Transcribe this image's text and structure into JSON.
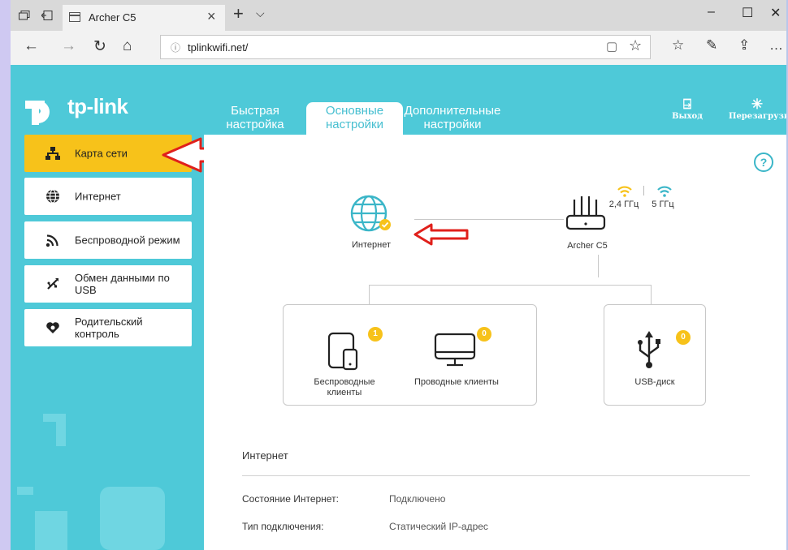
{
  "browser": {
    "tab_title": "Archer C5",
    "url": "tplinkwifi.net/"
  },
  "brand": {
    "logo_text": "tp-link",
    "accent": "#4ec9d8",
    "active_color": "#f7c21a"
  },
  "header": {
    "tabs": [
      {
        "label_line1": "Быстрая",
        "label_line2": "настройка"
      },
      {
        "label_line1": "Основные",
        "label_line2": "настройки"
      },
      {
        "label_line1": "Дополнительные",
        "label_line2": "настройки"
      }
    ],
    "logout_label": "Выход",
    "reboot_label": "Перезагрузка"
  },
  "sidebar": {
    "items": [
      {
        "label": "Карта сети",
        "icon": "network-map-icon"
      },
      {
        "label": "Интернет",
        "icon": "globe-icon"
      },
      {
        "label": "Беспроводной режим",
        "icon": "wireless-icon"
      },
      {
        "label": "Обмен данными по USB",
        "label_line1": "Обмен данными по",
        "label_line2": "USB",
        "icon": "usb-icon"
      },
      {
        "label": "Родительский контроль",
        "label_line1": "Родительский",
        "label_line2": "контроль",
        "icon": "parental-icon"
      }
    ]
  },
  "map": {
    "internet_label": "Интернет",
    "router_label": "Archer C5",
    "band_24": "2,4 ГГц",
    "band_5": "5 ГГц",
    "wireless_clients_line1": "Беспроводные",
    "wireless_clients_line2": "клиенты",
    "wireless_clients_count": "1",
    "wired_clients_label": "Проводные клиенты",
    "wired_clients_count": "0",
    "usb_label": "USB-диск",
    "usb_count": "0"
  },
  "internet_info": {
    "title": "Интернет",
    "rows": [
      {
        "key": "Состояние Интернет:",
        "value": "Подключено"
      },
      {
        "key": "Тип подключения:",
        "value": "Статический IP-адрес"
      }
    ]
  }
}
